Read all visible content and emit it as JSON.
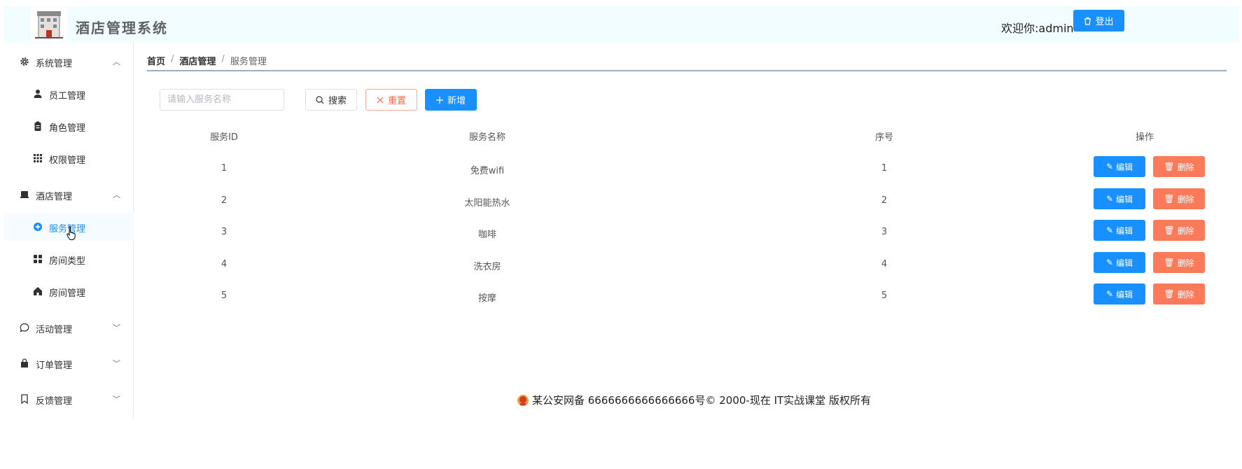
{
  "header": {
    "title": "酒店管理系统",
    "welcome": "欢迎你:admin",
    "logout_label": "登出"
  },
  "sidebar": {
    "groups": [
      {
        "label": "系统管理",
        "icon": "gear-icon",
        "expanded": true,
        "items": [
          {
            "label": "员工管理",
            "icon": "user-icon"
          },
          {
            "label": "角色管理",
            "icon": "clipboard-icon"
          },
          {
            "label": "权限管理",
            "icon": "grid-icon"
          }
        ]
      },
      {
        "label": "酒店管理",
        "icon": "hotel-icon",
        "expanded": true,
        "items": [
          {
            "label": "服务管理",
            "icon": "service-icon",
            "active": true
          },
          {
            "label": "房间类型",
            "icon": "menu-grid-icon"
          },
          {
            "label": "房间管理",
            "icon": "home-icon"
          }
        ]
      },
      {
        "label": "活动管理",
        "icon": "chat-icon",
        "expanded": false
      },
      {
        "label": "订单管理",
        "icon": "bag-icon",
        "expanded": false
      },
      {
        "label": "反馈管理",
        "icon": "bookmark-icon",
        "expanded": false
      }
    ]
  },
  "breadcrumb": {
    "home": "首页",
    "section": "酒店管理",
    "current": "服务管理",
    "separator": "/"
  },
  "toolbar": {
    "search_placeholder": "请输入服务名称",
    "search_label": "搜索",
    "reset_label": "重置",
    "add_label": "新增"
  },
  "table": {
    "columns": [
      "服务ID",
      "服务名称",
      "序号",
      "操作"
    ],
    "rows": [
      {
        "id": "1",
        "name": "免费wifi",
        "order": "1"
      },
      {
        "id": "2",
        "name": "太阳能热水",
        "order": "2"
      },
      {
        "id": "3",
        "name": "咖啡",
        "order": "3"
      },
      {
        "id": "4",
        "name": "洗衣房",
        "order": "4"
      },
      {
        "id": "5",
        "name": "按摩",
        "order": "5"
      }
    ],
    "edit_label": "编辑",
    "delete_label": "删除"
  },
  "footer": {
    "text": "某公安网备 6666666666666666号© 2000-现在 IT实战课堂 版权所有"
  },
  "colors": {
    "primary": "#1890ff",
    "danger": "#fa7a5a",
    "header_bg": "#f2fdff"
  }
}
